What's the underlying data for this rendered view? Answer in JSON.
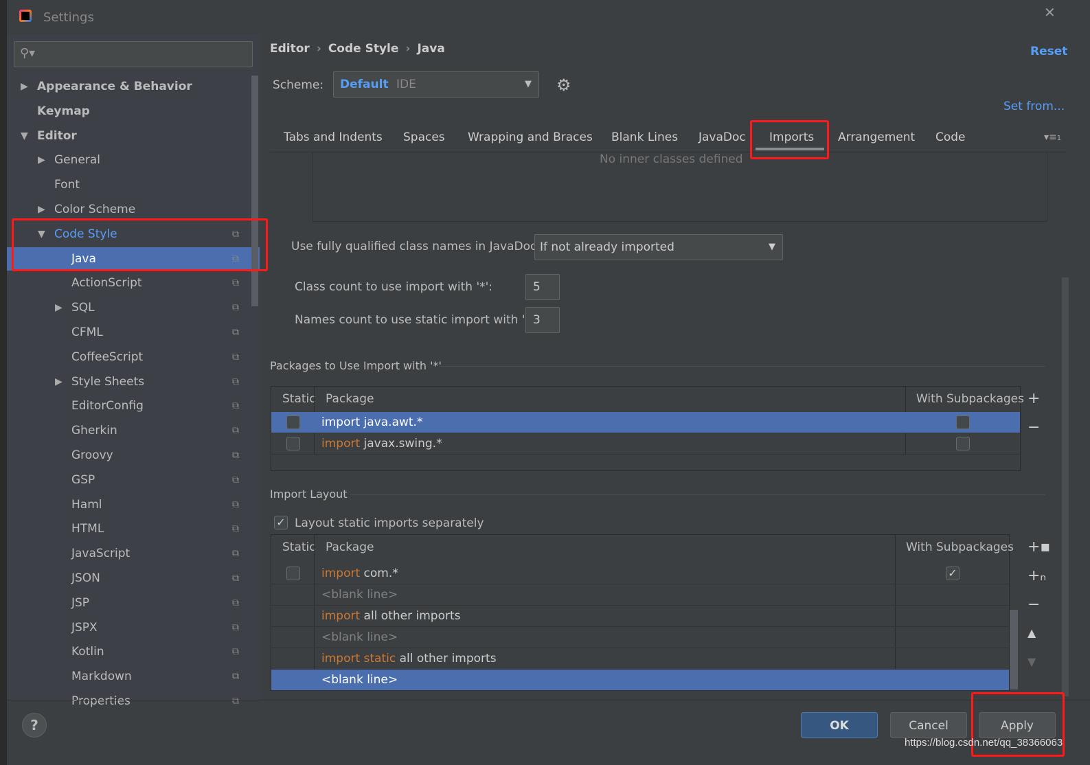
{
  "window": {
    "title": "Settings",
    "close_icon": "close-icon"
  },
  "search": {
    "placeholder": ""
  },
  "tree": [
    {
      "label": "Appearance & Behavior",
      "level": 0,
      "arrow": "right",
      "bold": true
    },
    {
      "label": "Keymap",
      "level": 0,
      "bold": true
    },
    {
      "label": "Editor",
      "level": 0,
      "arrow": "down",
      "bold": true
    },
    {
      "label": "General",
      "level": 1,
      "arrow": "right"
    },
    {
      "label": "Font",
      "level": 1
    },
    {
      "label": "Color Scheme",
      "level": 1,
      "arrow": "right"
    },
    {
      "label": "Code Style",
      "level": 1,
      "arrow": "down",
      "copy": true,
      "active": true
    },
    {
      "label": "Java",
      "level": 2,
      "copy": true,
      "selected": true
    },
    {
      "label": "ActionScript",
      "level": 2,
      "copy": true
    },
    {
      "label": "SQL",
      "level": 2,
      "arrow": "right",
      "copy": true
    },
    {
      "label": "CFML",
      "level": 2,
      "copy": true
    },
    {
      "label": "CoffeeScript",
      "level": 2,
      "copy": true
    },
    {
      "label": "Style Sheets",
      "level": 2,
      "arrow": "right",
      "copy": true
    },
    {
      "label": "EditorConfig",
      "level": 2,
      "copy": true
    },
    {
      "label": "Gherkin",
      "level": 2,
      "copy": true
    },
    {
      "label": "Groovy",
      "level": 2,
      "copy": true
    },
    {
      "label": "GSP",
      "level": 2,
      "copy": true
    },
    {
      "label": "Haml",
      "level": 2,
      "copy": true
    },
    {
      "label": "HTML",
      "level": 2,
      "copy": true
    },
    {
      "label": "JavaScript",
      "level": 2,
      "copy": true
    },
    {
      "label": "JSON",
      "level": 2,
      "copy": true
    },
    {
      "label": "JSP",
      "level": 2,
      "copy": true
    },
    {
      "label": "JSPX",
      "level": 2,
      "copy": true
    },
    {
      "label": "Kotlin",
      "level": 2,
      "copy": true
    },
    {
      "label": "Markdown",
      "level": 2,
      "copy": true
    },
    {
      "label": "Properties",
      "level": 2,
      "copy": true
    }
  ],
  "breadcrumb": [
    "Editor",
    "Code Style",
    "Java"
  ],
  "reset_label": "Reset",
  "scheme": {
    "label": "Scheme:",
    "name": "Default",
    "type": "IDE"
  },
  "set_from": "Set from...",
  "tabs": [
    "Tabs and Indents",
    "Spaces",
    "Wrapping and Braces",
    "Blank Lines",
    "JavaDoc",
    "Imports",
    "Arrangement",
    "Code Generatio"
  ],
  "active_tab": "Imports",
  "tabs_overflow": "1",
  "inner_classes_text": "No inner classes defined",
  "fqcn": {
    "label": "Use fully qualified class names in JavaDoc:",
    "value": "If not already imported"
  },
  "class_count": {
    "label": "Class count to use import with '*':",
    "value": "5"
  },
  "names_count": {
    "label": "Names count to use static import with '*':",
    "value": "3"
  },
  "packages": {
    "title": "Packages to Use Import with '*'",
    "headers": [
      "Static",
      "Package",
      "With Subpackages"
    ],
    "rows": [
      {
        "kw": "import",
        "text": " java.awt.*",
        "static": false,
        "sub": false,
        "selected": true
      },
      {
        "kw": "import",
        "text": " javax.swing.*",
        "static": false,
        "sub": false
      }
    ]
  },
  "layout": {
    "title": "Import Layout",
    "checkbox_label": "Layout static imports separately",
    "checked": true,
    "headers": [
      "Static",
      "Package",
      "With Subpackages"
    ],
    "rows": [
      {
        "kw": "import",
        "text": " com.*",
        "static": false,
        "sub": true
      },
      {
        "blank": "<blank line>"
      },
      {
        "kw": "import",
        "text": " all other imports"
      },
      {
        "blank": "<blank line>"
      },
      {
        "kw": "import static",
        "text": " all other imports"
      },
      {
        "blank": "<blank line>",
        "selected": true
      }
    ]
  },
  "buttons": {
    "ok": "OK",
    "cancel": "Cancel",
    "apply": "Apply",
    "help": "?"
  },
  "watermark": "https://blog.csdn.net/qq_38366063",
  "colors": {
    "accent": "#4b6eaf",
    "keyword": "#cc7832",
    "link": "#589df6",
    "highlight": "#ff1a1a"
  }
}
